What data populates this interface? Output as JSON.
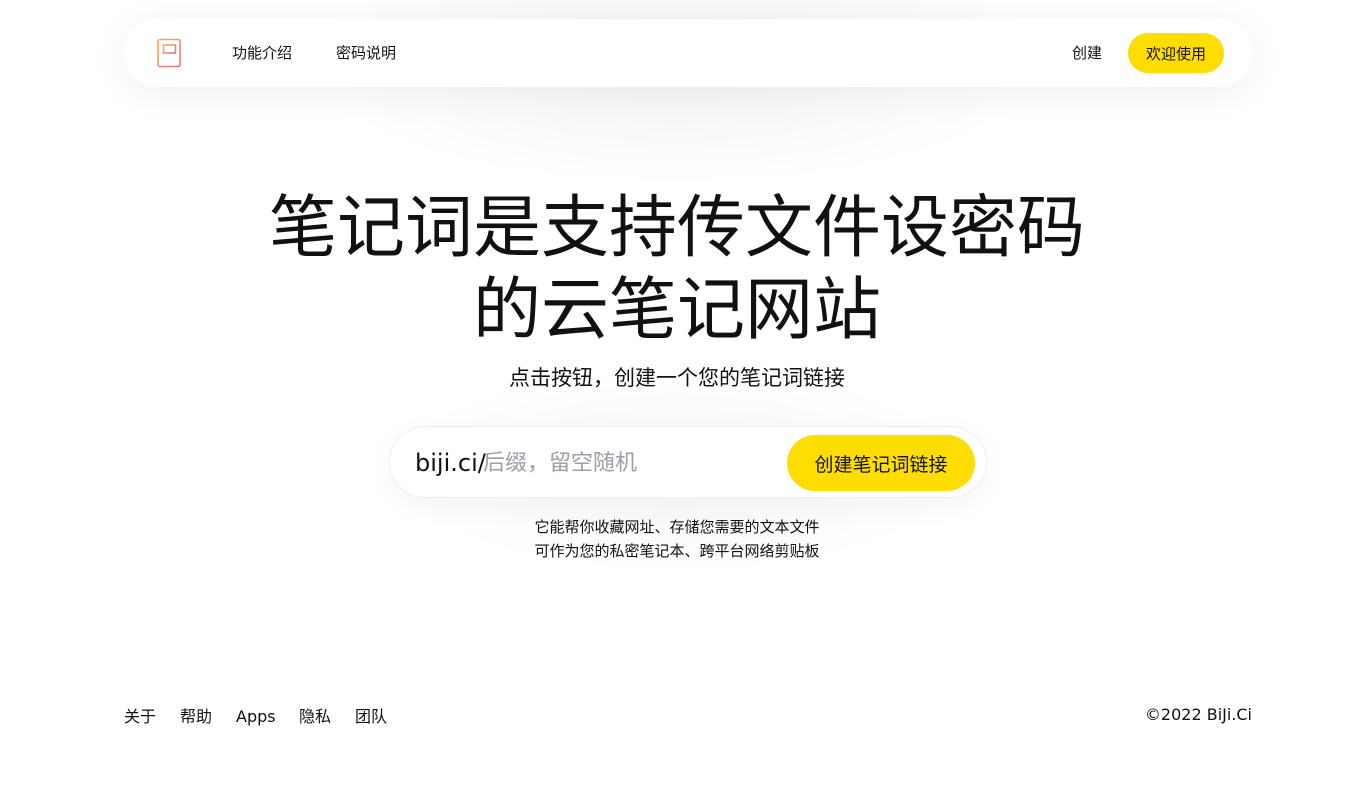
{
  "header": {
    "logo_icon": "notebook-icon",
    "nav": [
      {
        "label": "功能介绍"
      },
      {
        "label": "密码说明"
      }
    ],
    "create_label": "创建",
    "welcome_label": "欢迎使用"
  },
  "hero": {
    "title_line1": "笔记词是支持传文件设密码",
    "title_line2": "的云笔记网站",
    "subtitle": "点击按钮，创建一个您的笔记词链接"
  },
  "link_form": {
    "prefix": "biji.ci/",
    "placeholder": "后缀，留空随机",
    "value": "",
    "button_label": "创建笔记词链接"
  },
  "description": {
    "line1": "它能帮你收藏网址、存储您需要的文本文件",
    "line2": "可作为您的私密笔记本、跨平台网络剪贴板"
  },
  "footer": {
    "links": [
      {
        "label": "关于"
      },
      {
        "label": "帮助"
      },
      {
        "label": "Apps"
      },
      {
        "label": "隐私"
      },
      {
        "label": "团队"
      }
    ],
    "copyright": "©2022 BiJi.Ci"
  },
  "colors": {
    "accent": "#ffdd00",
    "text": "#111111",
    "placeholder": "#9aa0a8"
  }
}
